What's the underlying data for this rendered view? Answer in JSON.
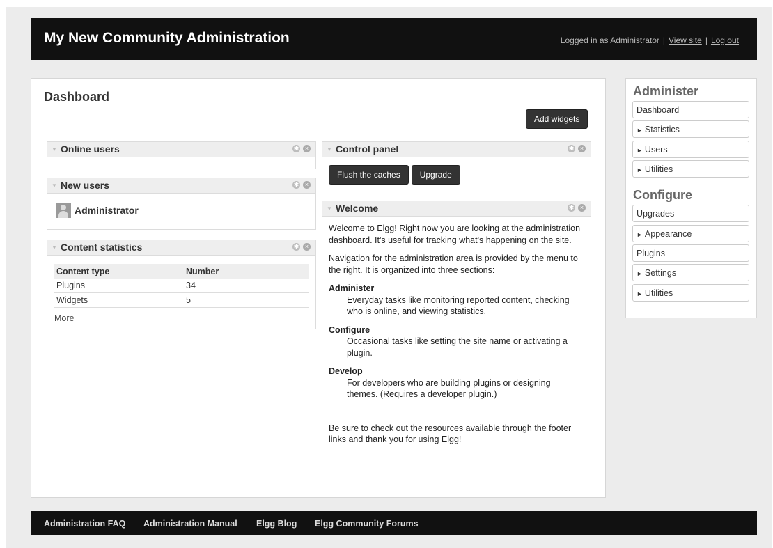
{
  "header": {
    "site_title": "My New Community Administration",
    "logged_in_text": "Logged in as Administrator",
    "view_site": "View site",
    "log_out": "Log out",
    "separator": "|"
  },
  "main": {
    "title": "Dashboard",
    "add_widgets": "Add widgets"
  },
  "widgets": {
    "online_users": {
      "title": "Online users"
    },
    "new_users": {
      "title": "New users",
      "users": [
        "Administrator"
      ]
    },
    "content_stats": {
      "title": "Content statistics",
      "columns": [
        "Content type",
        "Number"
      ],
      "rows": [
        [
          "Plugins",
          "34"
        ],
        [
          "Widgets",
          "5"
        ]
      ],
      "more": "More"
    },
    "control_panel": {
      "title": "Control panel",
      "flush": "Flush the caches",
      "upgrade": "Upgrade"
    },
    "welcome": {
      "title": "Welcome",
      "intro": "Welcome to Elgg! Right now you are looking at the administration dashboard. It's useful for tracking what's happening on the site.",
      "nav": "Navigation for the administration area is provided by the menu to the right. It is organized into three sections:",
      "sections": [
        {
          "term": "Administer",
          "desc": "Everyday tasks like monitoring reported content, checking who is online, and viewing statistics."
        },
        {
          "term": "Configure",
          "desc": "Occasional tasks like setting the site name or activating a plugin."
        },
        {
          "term": "Develop",
          "desc": "For developers who are building plugins or designing themes. (Requires a developer plugin.)"
        }
      ],
      "outro": "Be sure to check out the resources available through the footer links and thank you for using Elgg!"
    }
  },
  "sidebar": {
    "administer_heading": "Administer",
    "administer_items": [
      "Dashboard",
      "Statistics",
      "Users",
      "Utilities"
    ],
    "configure_heading": "Configure",
    "configure_items": [
      "Upgrades",
      "Appearance",
      "Plugins",
      "Settings",
      "Utilities"
    ]
  },
  "footer": {
    "links": [
      "Administration FAQ",
      "Administration Manual",
      "Elgg Blog",
      "Elgg Community Forums"
    ]
  },
  "icons": {
    "collapse": "triangle-down-icon",
    "settings": "gear-icon",
    "close": "close-icon",
    "submenu": "triangle-right-icon"
  },
  "colors": {
    "topbar": "#111111",
    "button": "#333333",
    "page_bg": "#ececec"
  }
}
